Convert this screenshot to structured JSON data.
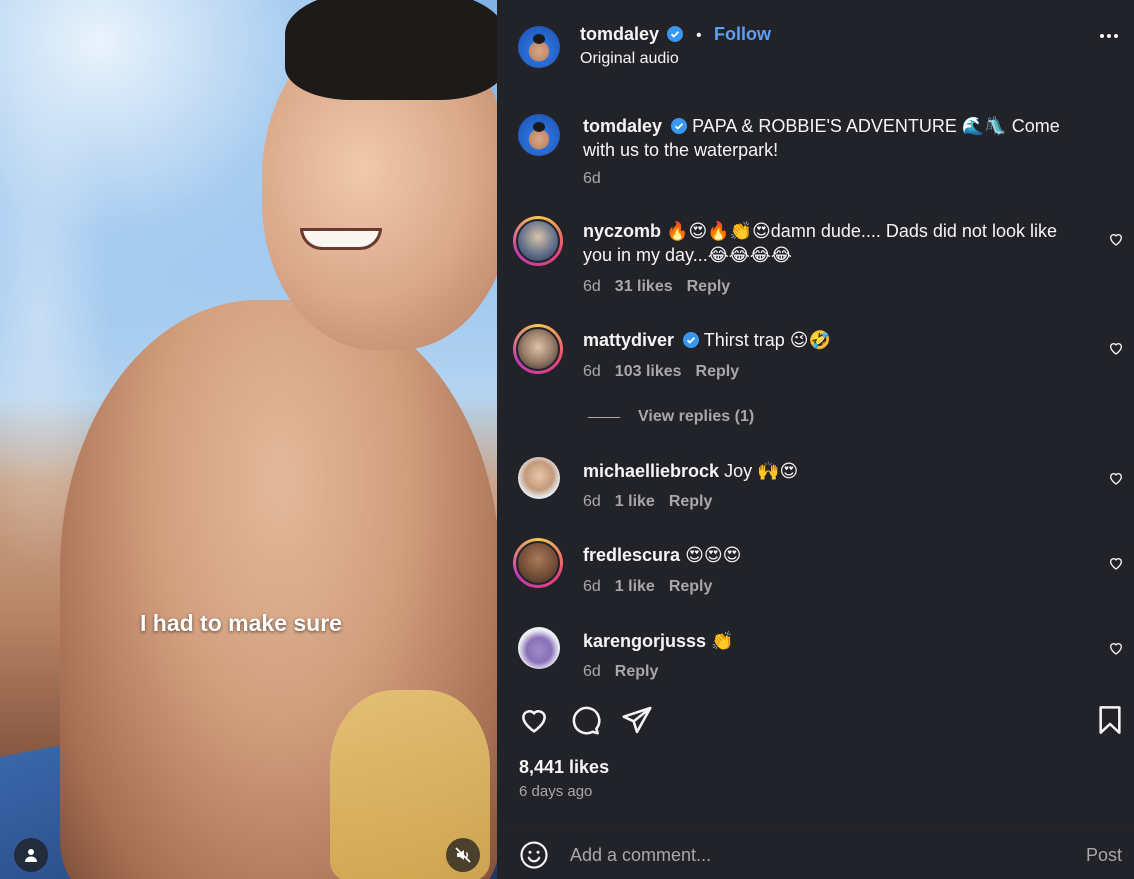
{
  "video": {
    "caption": "I had to make sure",
    "user_icon": "user-icon",
    "mute_icon": "speaker-muted-icon"
  },
  "header": {
    "username": "tomdaley",
    "separator": "•",
    "follow_label": "Follow",
    "audio": "Original audio",
    "more_icon": "more-options-icon"
  },
  "caption": {
    "username": "tomdaley",
    "text": "PAPA & ROBBIE'S ADVENTURE 🌊🛝 Come with us to the waterpark!",
    "time": "6d"
  },
  "comments": [
    {
      "username": "nyczomb",
      "text": "🔥😍🔥👏😍damn dude.... Dads did not look like you in my day...😂😂😂😂",
      "time": "6d",
      "likes": "31 likes",
      "reply": "Reply"
    },
    {
      "username": "mattydiver",
      "text": "Thirst trap 😉🤣",
      "time": "6d",
      "likes": "103 likes",
      "reply": "Reply"
    },
    {
      "username": "michaelliebrock",
      "text": "Joy 🙌😍",
      "time": "6d",
      "likes": "1 like",
      "reply": "Reply"
    },
    {
      "username": "fredlescura",
      "text": "😍😍😍",
      "time": "6d",
      "likes": "1 like",
      "reply": "Reply"
    },
    {
      "username": "karengorjusss",
      "text": "👏",
      "time": "6d",
      "reply": "Reply"
    }
  ],
  "view_replies": "View replies (1)",
  "stats": {
    "likes": "8,441 likes",
    "ago": "6 days ago"
  },
  "add_comment": {
    "placeholder": "Add a comment...",
    "post_label": "Post"
  },
  "colors": {
    "panel_bg": "#212328",
    "link_blue": "#5f9ef5",
    "muted_text": "#a8a8a8"
  }
}
